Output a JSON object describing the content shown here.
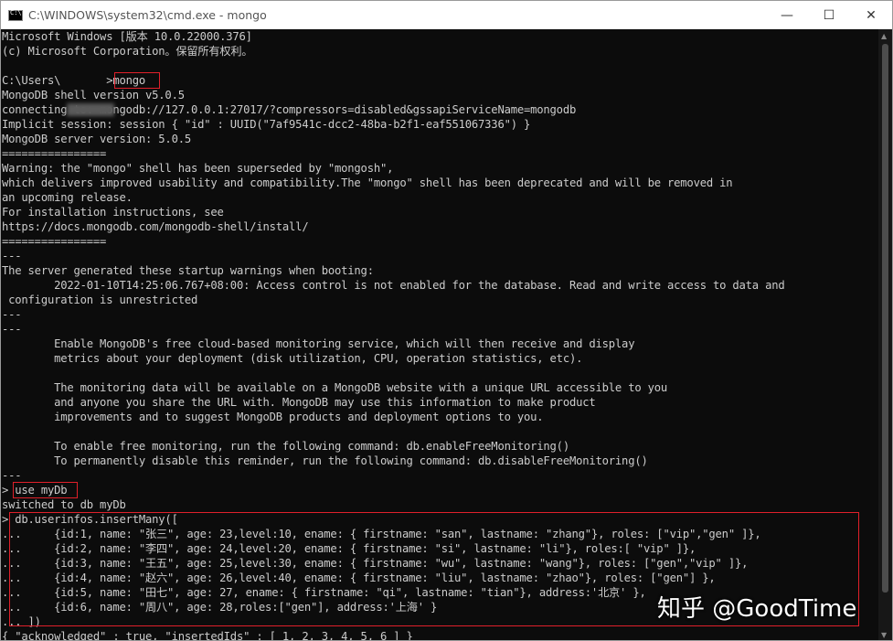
{
  "window": {
    "title": "C:\\WINDOWS\\system32\\cmd.exe - mongo",
    "controls": {
      "minimize": "—",
      "maximize": "☐",
      "close": "✕"
    }
  },
  "console": {
    "lines": [
      "Microsoft Windows [版本 10.0.22000.376]",
      "(c) Microsoft Corporation。保留所有权利。",
      "",
      "C:\\Users\\       >mongo",
      "MongoDB shell version v5.0.5",
      "connecting to: mongodb://127.0.0.1:27017/?compressors=disabled&gssapiServiceName=mongodb",
      "Implicit session: session { \"id\" : UUID(\"7af9541c-dcc2-48ba-b2f1-eaf551067336\") }",
      "MongoDB server version: 5.0.5",
      "================",
      "Warning: the \"mongo\" shell has been superseded by \"mongosh\",",
      "which delivers improved usability and compatibility.The \"mongo\" shell has been deprecated and will be removed in",
      "an upcoming release.",
      "For installation instructions, see",
      "https://docs.mongodb.com/mongodb-shell/install/",
      "================",
      "---",
      "The server generated these startup warnings when booting:",
      "        2022-01-10T14:25:06.767+08:00: Access control is not enabled for the database. Read and write access to data and",
      " configuration is unrestricted",
      "---",
      "---",
      "        Enable MongoDB's free cloud-based monitoring service, which will then receive and display",
      "        metrics about your deployment (disk utilization, CPU, operation statistics, etc).",
      "",
      "        The monitoring data will be available on a MongoDB website with a unique URL accessible to you",
      "        and anyone you share the URL with. MongoDB may use this information to make product",
      "        improvements and to suggest MongoDB products and deployment options to you.",
      "",
      "        To enable free monitoring, run the following command: db.enableFreeMonitoring()",
      "        To permanently disable this reminder, run the following command: db.disableFreeMonitoring()",
      "---",
      "> use myDb",
      "switched to db myDb",
      "> db.userinfos.insertMany([",
      "...     {id:1, name: \"张三\", age: 23,level:10, ename: { firstname: \"san\", lastname: \"zhang\"}, roles: [\"vip\",\"gen\" ]},",
      "...     {id:2, name: \"李四\", age: 24,level:20, ename: { firstname: \"si\", lastname: \"li\"}, roles:[ \"vip\" ]},",
      "...     {id:3, name: \"王五\", age: 25,level:30, ename: { firstname: \"wu\", lastname: \"wang\"}, roles: [\"gen\",\"vip\" ]},",
      "...     {id:4, name: \"赵六\", age: 26,level:40, ename: { firstname: \"liu\", lastname: \"zhao\"}, roles: [\"gen\"] },",
      "...     {id:5, name: \"田七\", age: 27, ename: { firstname: \"qi\", lastname: \"tian\"}, address:'北京' },",
      "...     {id:6, name: \"周八\", age: 28,roles:[\"gen\"], address:'上海' }",
      "... ])",
      "{ \"acknowledged\" : true, \"insertedIds\" : [ 1, 2, 3, 4, 5, 6 ] }"
    ]
  },
  "watermark": "知乎 @GoodTime",
  "colors": {
    "console_bg": "#0c0c0c",
    "console_fg": "#cccccc",
    "highlight": "#e0202a"
  }
}
